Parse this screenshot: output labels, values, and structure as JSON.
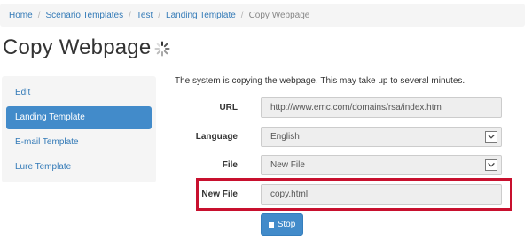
{
  "breadcrumb": {
    "items": [
      "Home",
      "Scenario Templates",
      "Test",
      "Landing Template"
    ],
    "current": "Copy Webpage"
  },
  "page": {
    "title": "Copy Webpage"
  },
  "sidebar": {
    "items": [
      {
        "label": "Edit",
        "active": false
      },
      {
        "label": "Landing Template",
        "active": true
      },
      {
        "label": "E-mail Template",
        "active": false
      },
      {
        "label": "Lure Template",
        "active": false
      }
    ]
  },
  "form": {
    "intro": "The system is copying the webpage. This may take up to several minutes.",
    "url": {
      "label": "URL",
      "value": "http://www.emc.com/domains/rsa/index.htm"
    },
    "language": {
      "label": "Language",
      "value": "English"
    },
    "file": {
      "label": "File",
      "value": "New File"
    },
    "new_file": {
      "label": "New File",
      "value": "copy.html"
    },
    "stop_label": "Stop"
  },
  "colors": {
    "accent": "#428bca",
    "link": "#337ab7",
    "highlight": "#c8102e"
  },
  "icons": {
    "spinner": "loading-spinner-icon",
    "stop": "stop-square-icon",
    "dropdown": "chevron-down-icon"
  }
}
